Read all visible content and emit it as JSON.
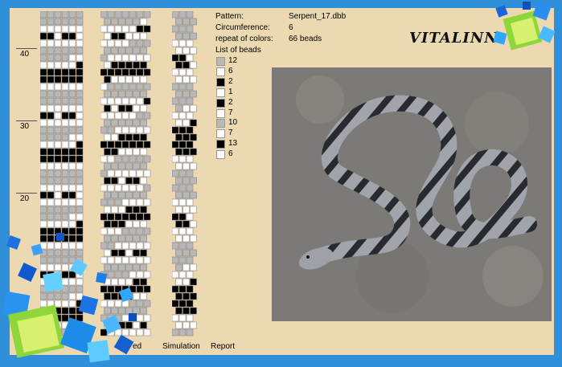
{
  "info": {
    "pattern_label": "Pattern:",
    "pattern_value": "Serpent_17.dbb",
    "circ_label": "Circumference:",
    "circ_value": "6",
    "repeat_label": "repeat of colors:",
    "repeat_value": "66 beads",
    "list_label": "List of beads"
  },
  "legend": [
    {
      "color": "#b8b8b8",
      "count": "12"
    },
    {
      "color": "#ffffff",
      "count": "6"
    },
    {
      "color": "#000000",
      "count": "2"
    },
    {
      "color": "#ffffff",
      "count": "1"
    },
    {
      "color": "#000000",
      "count": "2"
    },
    {
      "color": "#ffffff",
      "count": "7"
    },
    {
      "color": "#b8b8b8",
      "count": "10"
    },
    {
      "color": "#ffffff",
      "count": "7"
    },
    {
      "color": "#000000",
      "count": "13"
    },
    {
      "color": "#ffffff",
      "count": "6"
    }
  ],
  "ruler": [
    "40",
    "30",
    "20"
  ],
  "tabs": {
    "corrected": "ed",
    "simulation": "Simulation",
    "report": "Report"
  },
  "logo": "VITALINN",
  "colors": {
    "frame": "#2f8fd8",
    "panel": "#ecd9b2",
    "grey": "#b8b8b8",
    "black": "#000000",
    "white": "#ffffff"
  }
}
